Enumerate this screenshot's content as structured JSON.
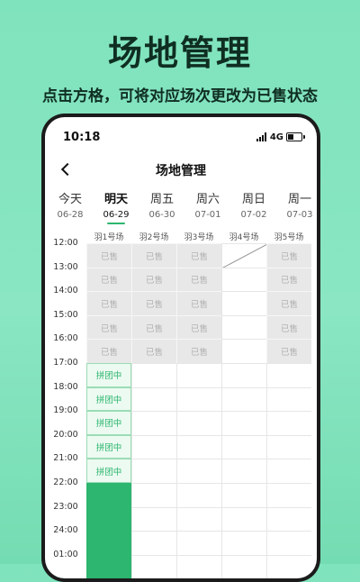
{
  "hero": {
    "title": "场地管理",
    "subtitle": "点击方格，可将对应场次更改为已售状态"
  },
  "status_bar": {
    "time": "10:18",
    "network": "4G"
  },
  "nav": {
    "title": "场地管理"
  },
  "days": [
    {
      "name": "今天",
      "date": "06-28"
    },
    {
      "name": "明天",
      "date": "06-29",
      "active": true
    },
    {
      "name": "周五",
      "date": "06-30"
    },
    {
      "name": "周六",
      "date": "07-01"
    },
    {
      "name": "周日",
      "date": "07-02"
    },
    {
      "name": "周一",
      "date": "07-03"
    }
  ],
  "courts": [
    "羽1号场",
    "羽2号场",
    "羽3号场",
    "羽4号场",
    "羽5号场"
  ],
  "times": [
    "12:00",
    "13:00",
    "14:00",
    "15:00",
    "16:00",
    "17:00",
    "18:00",
    "19:00",
    "20:00",
    "21:00",
    "22:00",
    "23:00",
    "24:00",
    "01:00"
  ],
  "grid": {
    "sold_label": "已售",
    "group_label": "拼团中",
    "rows": [
      [
        "sold",
        "sold",
        "sold",
        "diagonal",
        "sold"
      ],
      [
        "sold",
        "sold",
        "sold",
        "empty",
        "sold"
      ],
      [
        "sold",
        "sold",
        "sold",
        "empty",
        "sold"
      ],
      [
        "sold",
        "sold",
        "sold",
        "empty",
        "sold"
      ],
      [
        "sold",
        "sold",
        "sold",
        "empty",
        "sold"
      ],
      [
        "group",
        "empty",
        "empty",
        "empty",
        "empty"
      ],
      [
        "group",
        "empty",
        "empty",
        "empty",
        "empty"
      ],
      [
        "group",
        "empty",
        "empty",
        "empty",
        "empty"
      ],
      [
        "group",
        "empty",
        "empty",
        "empty",
        "empty"
      ],
      [
        "group",
        "empty",
        "empty",
        "empty",
        "empty"
      ],
      [
        "booked",
        "empty",
        "empty",
        "empty",
        "empty"
      ],
      [
        "booked",
        "empty",
        "empty",
        "empty",
        "empty"
      ],
      [
        "booked",
        "empty",
        "empty",
        "empty",
        "empty"
      ],
      [
        "booked",
        "empty",
        "empty",
        "empty",
        "empty"
      ]
    ]
  },
  "colors": {
    "accent": "#2cb66f",
    "sold_bg": "#e8e8e8",
    "background": "#8ae6c3"
  }
}
